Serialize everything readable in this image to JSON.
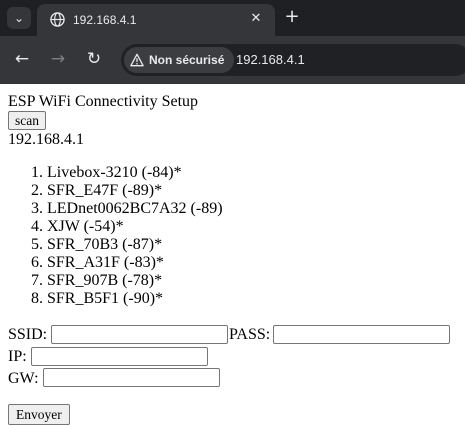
{
  "browser": {
    "tab": {
      "title": "192.168.4.1"
    },
    "omnibox": {
      "security_label": "Non sécurisé",
      "url": "192.168.4.1"
    }
  },
  "page": {
    "title": "ESP WiFi Connectivity Setup",
    "scan_label": "scan",
    "ip": "192.168.4.1",
    "networks": [
      "Livebox-3210 (-84)*",
      "SFR_E47F (-89)*",
      "LEDnet0062BC7A32 (-89)",
      "XJW (-54)*",
      "SFR_70B3 (-87)*",
      "SFR_A31F (-83)*",
      "SFR_907B (-78)*",
      "SFR_B5F1 (-90)*"
    ],
    "form": {
      "ssid_label": "SSID:",
      "pass_label": "PASS:",
      "ip_label": "IP:",
      "gw_label": "GW:",
      "ssid_value": "",
      "pass_value": "",
      "ip_value": "",
      "gw_value": "",
      "submit_label": "Envoyer"
    }
  }
}
